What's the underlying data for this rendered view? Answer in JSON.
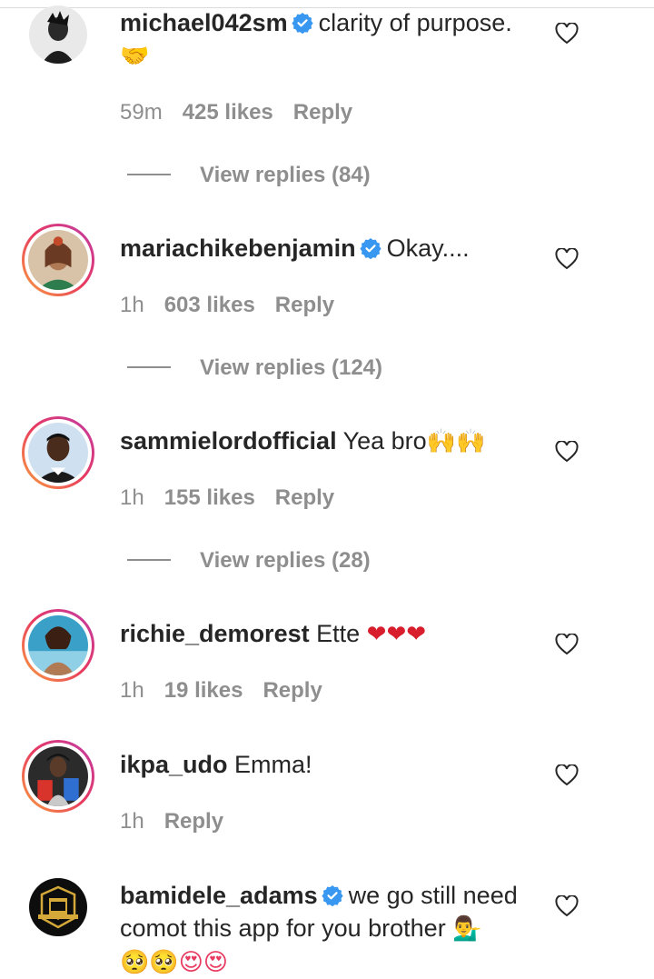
{
  "comments": [
    {
      "username": "michael042sm",
      "verified": true,
      "text": "clarity of purpose.",
      "emoji": "🤝",
      "time": "59m",
      "likes": "425 likes",
      "reply": "Reply",
      "view_replies": "View replies (84)",
      "avatar": "michael042sm-avatar"
    },
    {
      "username": "mariachikebenjamin",
      "verified": true,
      "text": "Okay....",
      "time": "1h",
      "likes": "603 likes",
      "reply": "Reply",
      "view_replies": "View replies (124)",
      "avatar": "mariachikebenjamin-avatar"
    },
    {
      "username": "sammielordofficial",
      "verified": false,
      "text": "Yea bro",
      "emoji": "🙌🙌",
      "time": "1h",
      "likes": "155 likes",
      "reply": "Reply",
      "view_replies": "View replies (28)",
      "avatar": "sammielordofficial-avatar"
    },
    {
      "username": "richie_demorest",
      "verified": false,
      "text": "Ette",
      "emoji": "❤❤❤",
      "time": "1h",
      "likes": "19 likes",
      "reply": "Reply",
      "avatar": "richie-demorest-avatar"
    },
    {
      "username": "ikpa_udo",
      "verified": false,
      "text": "Emma!",
      "time": "1h",
      "reply": "Reply",
      "avatar": "ikpa-udo-avatar"
    },
    {
      "username": "bamidele_adams",
      "verified": true,
      "text": "we go still need comot this app for you brother",
      "emoji": "💁‍♂️",
      "emoji_line2": "🥺🥺😍😍",
      "avatar": "bamidele-adams-avatar"
    }
  ],
  "colors": {
    "text": "#262626",
    "muted": "#8e8e8e",
    "verified": "#3897f0",
    "story_ring_start": "#f9a33e",
    "story_ring_end": "#c03aa8"
  }
}
